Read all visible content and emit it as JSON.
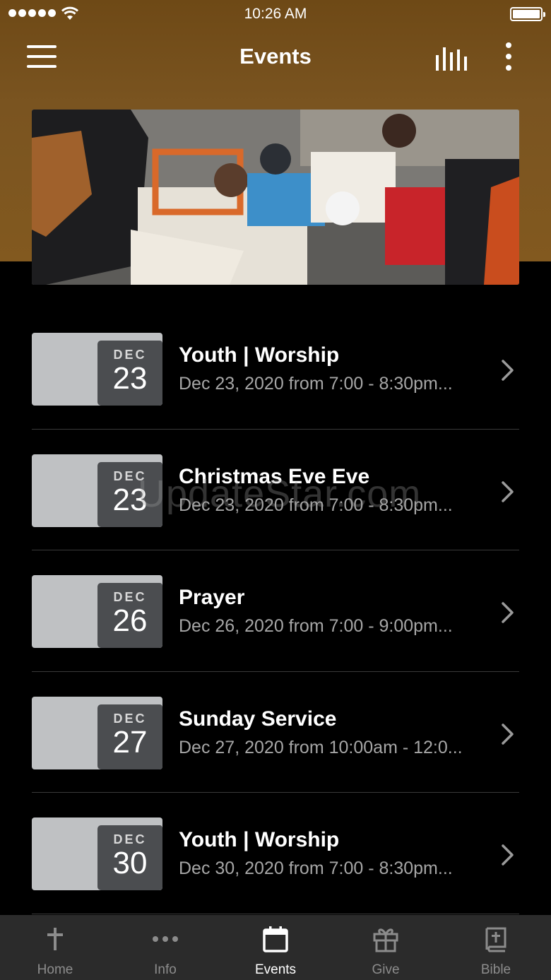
{
  "status_bar": {
    "time": "10:26 AM"
  },
  "nav": {
    "title": "Events"
  },
  "watermark": "UpdateStar.com",
  "events": [
    {
      "month": "DEC",
      "day": "23",
      "title": "Youth | Worship",
      "subtitle": "Dec 23, 2020 from 7:00 - 8:30pm..."
    },
    {
      "month": "DEC",
      "day": "23",
      "title": "Christmas Eve Eve",
      "subtitle": "Dec 23, 2020 from 7:00 - 8:30pm..."
    },
    {
      "month": "DEC",
      "day": "26",
      "title": "Prayer",
      "subtitle": "Dec 26, 2020 from 7:00 - 9:00pm..."
    },
    {
      "month": "DEC",
      "day": "27",
      "title": "Sunday Service",
      "subtitle": "Dec 27, 2020 from 10:00am - 12:0..."
    },
    {
      "month": "DEC",
      "day": "30",
      "title": "Youth | Worship",
      "subtitle": "Dec 30, 2020 from 7:00 - 8:30pm..."
    }
  ],
  "tabs": [
    {
      "label": "Home",
      "icon": "cross-icon",
      "active": false
    },
    {
      "label": "Info",
      "icon": "dots-icon",
      "active": false
    },
    {
      "label": "Events",
      "icon": "calendar-icon",
      "active": true
    },
    {
      "label": "Give",
      "icon": "gift-icon",
      "active": false
    },
    {
      "label": "Bible",
      "icon": "bible-icon",
      "active": false
    }
  ],
  "colors": {
    "header": "#7a5420",
    "tab_bar": "#2b2b2b",
    "date_box": "#4b4d50",
    "thumb": "#bfc1c3"
  }
}
